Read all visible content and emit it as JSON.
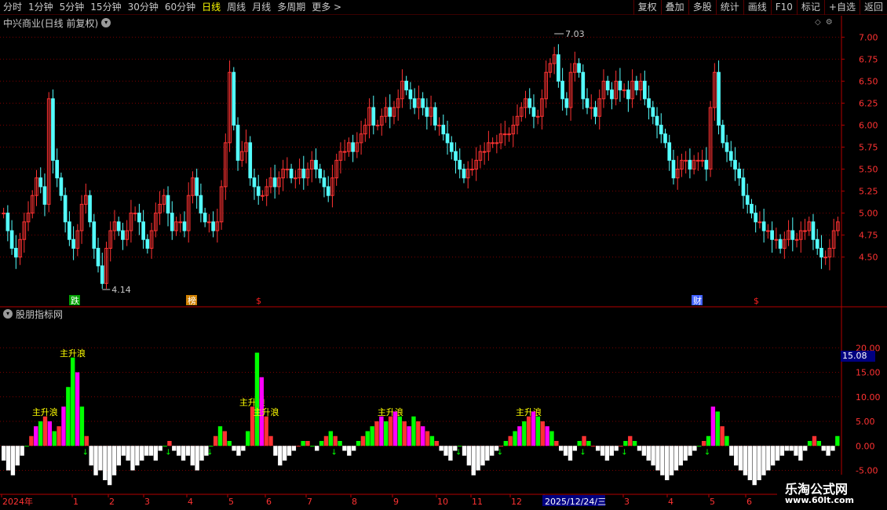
{
  "toolbar": {
    "left_items": [
      "分时",
      "1分钟",
      "5分钟",
      "15分钟",
      "30分钟",
      "60分钟",
      "日线",
      "周线",
      "月线",
      "多周期",
      "更多 >"
    ],
    "active_item": "日线",
    "right_items": [
      "复权",
      "叠加",
      "多股",
      "统计",
      "画线",
      "F10",
      "标记",
      "+自选",
      "返回"
    ]
  },
  "main_chart": {
    "title": "中兴商业(日线 前复权)",
    "high_label": "7.03",
    "low_label": "4.14",
    "y_ticks": [
      "7.00",
      "6.75",
      "6.50",
      "6.25",
      "6.00",
      "5.75",
      "5.50",
      "5.25",
      "5.00",
      "4.75",
      "4.50"
    ],
    "markers": [
      {
        "text": "跌",
        "color": "#00a000"
      },
      {
        "text": "榜",
        "color": "#d08000"
      },
      {
        "text": "$",
        "color": "#ff2020"
      },
      {
        "text": "财",
        "color": "#4060ff"
      },
      {
        "text": "$",
        "color": "#ff2020"
      }
    ]
  },
  "indicator": {
    "title": "股朋指标网",
    "y_ticks": [
      "20.00",
      "15.00",
      "10.00",
      "5.00",
      "0.00",
      "-5.00"
    ],
    "current_value": "15.08",
    "wave_label": "主升浪"
  },
  "date_axis": {
    "labels": [
      "2024年",
      "1",
      "2",
      "3",
      "4",
      "5",
      "6",
      "7",
      "8",
      "9",
      "10",
      "11",
      "12",
      "2025/12/24/三",
      "3",
      "4",
      "5",
      "6"
    ]
  },
  "watermark": {
    "line1": "乐淘公式网",
    "line2": "www.60lt.com"
  },
  "colors": {
    "up": "#ff3232",
    "down": "#54ffff",
    "grid": "#7a0000",
    "axis": "#b40000",
    "magenta": "#ff00ff",
    "green": "#00ff00",
    "yellow": "#ffff00"
  },
  "chart_data": {
    "type": "candlestick",
    "ylim": [
      4.14,
      7.03
    ],
    "indicator_ylim": [
      -7,
      25
    ],
    "closes": [
      5.0,
      4.8,
      4.6,
      4.5,
      4.7,
      4.9,
      5.0,
      5.2,
      5.4,
      5.3,
      5.1,
      6.3,
      5.6,
      5.4,
      5.2,
      4.9,
      4.7,
      4.6,
      4.8,
      5.1,
      5.2,
      4.9,
      4.6,
      4.4,
      4.2,
      4.6,
      4.8,
      4.9,
      4.8,
      4.7,
      4.8,
      5.0,
      5.0,
      4.9,
      4.7,
      4.6,
      4.8,
      5.0,
      5.1,
      5.2,
      5.0,
      4.8,
      4.9,
      4.9,
      4.8,
      5.2,
      5.4,
      5.2,
      5.0,
      4.9,
      4.9,
      4.8,
      4.9,
      5.3,
      5.8,
      6.6,
      6.0,
      5.6,
      5.7,
      5.8,
      5.4,
      5.3,
      5.2,
      5.2,
      5.3,
      5.4,
      5.3,
      5.4,
      5.5,
      5.5,
      5.4,
      5.4,
      5.5,
      5.4,
      5.5,
      5.6,
      5.5,
      5.4,
      5.3,
      5.2,
      5.4,
      5.6,
      5.7,
      5.7,
      5.8,
      5.7,
      5.8,
      5.9,
      6.0,
      6.2,
      6.0,
      6.0,
      6.1,
      6.2,
      6.1,
      6.2,
      6.3,
      6.5,
      6.4,
      6.3,
      6.2,
      6.3,
      6.2,
      6.1,
      6.2,
      6.0,
      6.0,
      5.9,
      5.8,
      5.7,
      5.6,
      5.5,
      5.4,
      5.5,
      5.5,
      5.6,
      5.7,
      5.7,
      5.8,
      5.8,
      5.8,
      5.9,
      5.9,
      5.9,
      6.0,
      6.1,
      6.2,
      6.3,
      6.2,
      6.1,
      6.1,
      6.3,
      6.6,
      6.7,
      6.8,
      6.5,
      6.3,
      6.2,
      6.6,
      6.7,
      6.6,
      6.3,
      6.2,
      6.2,
      6.1,
      6.3,
      6.5,
      6.4,
      6.3,
      6.5,
      6.4,
      6.4,
      6.3,
      6.5,
      6.4,
      6.5,
      6.3,
      6.2,
      6.1,
      6.0,
      5.9,
      5.8,
      5.6,
      5.4,
      5.5,
      5.6,
      5.6,
      5.5,
      5.6,
      5.6,
      5.6,
      5.5,
      6.2,
      6.6,
      6.0,
      5.8,
      5.7,
      5.6,
      5.5,
      5.4,
      5.2,
      5.1,
      5.0,
      4.9,
      4.9,
      4.8,
      4.8,
      4.7,
      4.7,
      4.6,
      4.7,
      4.8,
      4.7,
      4.7,
      4.8,
      4.8,
      4.9,
      4.7,
      4.6,
      4.5,
      4.5,
      4.6,
      4.8,
      4.9
    ],
    "indicator_values": [
      -3,
      -5,
      -6,
      -4,
      -2,
      0,
      2,
      4,
      5,
      6,
      5,
      3,
      4,
      8,
      12,
      18,
      15,
      8,
      2,
      -4,
      -6,
      -5,
      -7,
      -8,
      -6,
      -4,
      -2,
      -3,
      -5,
      -4,
      -3,
      -2,
      -2,
      -3,
      -1,
      0,
      1,
      -1,
      -2,
      -3,
      -2,
      -4,
      -5,
      -3,
      -2,
      0,
      2,
      4,
      3,
      1,
      -1,
      -2,
      -1,
      3,
      8,
      19,
      14,
      6,
      2,
      -2,
      -4,
      -3,
      -2,
      -1,
      0,
      1,
      1,
      0,
      -1,
      1,
      2,
      3,
      2,
      1,
      -1,
      -2,
      -1,
      1,
      2,
      3,
      4,
      5,
      6,
      5,
      6,
      7,
      6,
      5,
      4,
      6,
      5,
      4,
      3,
      2,
      1,
      -1,
      -2,
      -3,
      -1,
      0,
      -2,
      -4,
      -6,
      -5,
      -4,
      -3,
      -2,
      -1,
      0,
      1,
      2,
      3,
      4,
      5,
      6,
      7,
      6,
      5,
      4,
      3,
      1,
      -1,
      -2,
      -3,
      -1,
      1,
      2,
      1,
      0,
      -1,
      -2,
      -3,
      -2,
      -1,
      0,
      1,
      2,
      1,
      -1,
      -2,
      -3,
      -4,
      -5,
      -6,
      -7,
      -6,
      -5,
      -4,
      -3,
      -2,
      -1,
      0,
      1,
      2,
      8,
      7,
      4,
      2,
      -2,
      -4,
      -5,
      -6,
      -7,
      -8,
      -7,
      -6,
      -5,
      -4,
      -3,
      -2,
      -1,
      -1,
      -2,
      -3,
      -1,
      1,
      2,
      1,
      -1,
      -2,
      -1,
      2
    ]
  }
}
